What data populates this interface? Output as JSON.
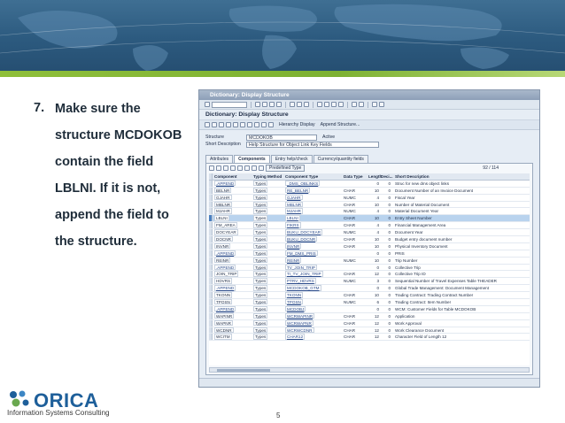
{
  "bullet": {
    "number": "7.",
    "lines": [
      "Make sure the",
      "structure MCDOKOB",
      "contain the field",
      "LBLNI. If it is not,",
      "append the field to",
      "the structure."
    ]
  },
  "sap": {
    "window_title": "Dictionary: Display Structure",
    "screen_title": "Dictionary: Display Structure",
    "appbar": {
      "hierarchy": "Hierarchy Display",
      "append": "Append Structure..."
    },
    "fields": {
      "structure_label": "Structure",
      "structure_value": "MCDOKOB",
      "status": "Active",
      "short_desc_label": "Short Description",
      "short_desc_value": "Help Structure for Object Link Key Fields"
    },
    "tabs": [
      "Attributes",
      "Components",
      "Entry help/check",
      "Currency/quantity fields"
    ],
    "active_tab": 1,
    "predefined_type": "Predefined Type",
    "pager": "92 / 114",
    "columns": [
      "Component",
      "Typing Method",
      "Component Type",
      "Data Type",
      "Length",
      "Deci...",
      "Short Description"
    ],
    "rows": [
      [
        ".APPEND",
        "Types",
        "_DMS_OBLINKS",
        "",
        "0",
        "0",
        "Struc for new dms object links"
      ],
      [
        "BELNR",
        "Types",
        "RE_BELNR",
        "CHAR",
        "10",
        "0",
        "Document Number of an Invoice Document"
      ],
      [
        "GJAHR",
        "Types",
        "GJAHR",
        "NUMC",
        "4",
        "0",
        "Fiscal Year"
      ],
      [
        "MBLNR",
        "Types",
        "MBLNR",
        "CHAR",
        "10",
        "0",
        "Number of Material Document"
      ],
      [
        "MJAHR",
        "Types",
        "MJAHR",
        "NUMC",
        "4",
        "0",
        "Material Document Year"
      ],
      [
        "LBLNI",
        "Types",
        "LBLNI",
        "CHAR",
        "10",
        "0",
        "Entry Sheet Number"
      ],
      [
        "FM_AREA",
        "Types",
        "FIKRS",
        "CHAR",
        "4",
        "0",
        "Financial Management Area"
      ],
      [
        "DOCYEAR",
        "Types",
        "BUKU_DOCYEAR",
        "NUMC",
        "4",
        "0",
        "Document Year"
      ],
      [
        "DOCNR",
        "Types",
        "BUKU_DOCNR",
        "CHAR",
        "10",
        "0",
        "Budget entry document number"
      ],
      [
        "INVNR",
        "Types",
        "INVNR",
        "CHAR",
        "10",
        "0",
        "Physical Inventory Document"
      ],
      [
        ".APPEND",
        "Types",
        "FM_DMS_PRIS",
        "",
        "0",
        "0",
        "PRIS"
      ],
      [
        "REINR",
        "Types",
        "REINR",
        "NUMC",
        "10",
        "0",
        "Trip Number"
      ],
      [
        ".APPEND",
        "Types",
        "TV_JOIN_TRIP",
        "",
        "0",
        "0",
        "Collective Trip"
      ],
      [
        "JOIN_TRIP",
        "Types",
        "TI_TV_JOIN_TRIP",
        "CHAR",
        "12",
        "0",
        "Collective Trip ID"
      ],
      [
        "HDVRS",
        "Types",
        "PTRV_HDVRS",
        "NUMC",
        "3",
        "0",
        "Sequential Number of Travel Expenses Table THEADER"
      ],
      [
        ".APPEND",
        "Types",
        "MCDOKOB_GTM",
        "",
        "0",
        "0",
        "Global Trade Management: Document Management"
      ],
      [
        "TKONN",
        "Types",
        "TKONN",
        "CHAR",
        "10",
        "0",
        "Trading Contract: Trading Contract Number"
      ],
      [
        "TPOSN",
        "Types",
        "TPOSN",
        "NUMC",
        "6",
        "0",
        "Trading Contract: Item Number"
      ],
      [
        ".APPEND",
        "Types",
        "MCDOBJ",
        "",
        "0",
        "0",
        "WCM: Customer Fields for Table MCDOKOB"
      ],
      [
        "WAPINR",
        "Types",
        "WCRWAPINR",
        "CHAR",
        "12",
        "0",
        "Application"
      ],
      [
        "WAPNR",
        "Types",
        "WCRWAPNR",
        "CHAR",
        "12",
        "0",
        "Work Approval"
      ],
      [
        "WCDNR",
        "Types",
        "WCRWCDNR",
        "CHAR",
        "12",
        "0",
        "Work Clearance Document"
      ],
      [
        "WCITM",
        "Types",
        "CHAR12",
        "CHAR",
        "12",
        "0",
        "Character Field of Length 12"
      ]
    ],
    "selected_row": 5
  },
  "footer": {
    "logo_word": "ORICA",
    "logo_sub": "Information Systems Consulting",
    "page_number": "5"
  },
  "colors": {
    "header_blue": "#2c5a7f",
    "accent_green": "#8fbf3a",
    "logo_blue": "#1e5f9a",
    "selection": "#b9d3ee"
  }
}
